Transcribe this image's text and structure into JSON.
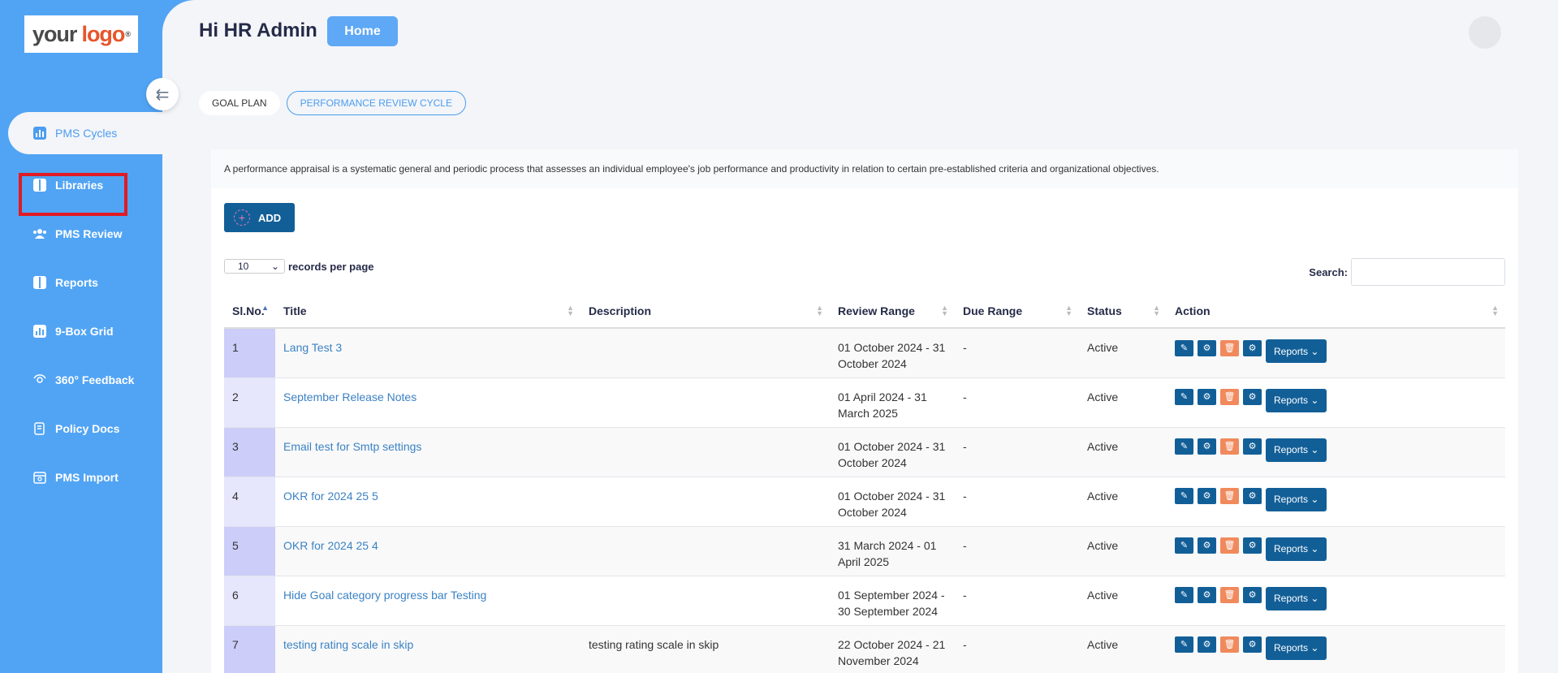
{
  "logo": {
    "your": "your",
    "logo": "logo",
    "reg": "®"
  },
  "sidebar": {
    "items": [
      {
        "label": "PMS Cycles",
        "icon": "bar-chart-icon"
      },
      {
        "label": "Libraries",
        "icon": "book-icon"
      },
      {
        "label": "PMS Review",
        "icon": "users-icon"
      },
      {
        "label": "Reports",
        "icon": "book-icon"
      },
      {
        "label": "9-Box Grid",
        "icon": "bar-chart-icon"
      },
      {
        "label": "360° Feedback",
        "icon": "feedback-icon"
      },
      {
        "label": "Policy Docs",
        "icon": "document-icon"
      },
      {
        "label": "PMS Import",
        "icon": "calendar-icon"
      }
    ]
  },
  "header": {
    "greeting": "Hi HR Admin",
    "home_label": "Home"
  },
  "tabs": [
    "GOAL PLAN",
    "PERFORMANCE REVIEW CYCLE"
  ],
  "description": "A performance appraisal is a systematic general and periodic process that assesses an individual employee's job performance and productivity in relation to certain pre-established criteria and organizational objectives.",
  "add_label": "ADD",
  "per_page": {
    "value": "10",
    "label": "records per page"
  },
  "search_label": "Search:",
  "table": {
    "headers": [
      "Sl.No.",
      "Title",
      "Description",
      "Review Range",
      "Due Range",
      "Status",
      "Action"
    ],
    "reports_label": "Reports",
    "rows": [
      {
        "sl": "1",
        "title": "Lang Test 3",
        "desc": "",
        "review": "01 October 2024 - 31 October 2024",
        "due": "-",
        "status": "Active"
      },
      {
        "sl": "2",
        "title": "September Release Notes",
        "desc": "",
        "review": "01 April 2024 - 31 March 2025",
        "due": "-",
        "status": "Active"
      },
      {
        "sl": "3",
        "title": "Email test for Smtp settings",
        "desc": "",
        "review": "01 October 2024 - 31 October 2024",
        "due": "-",
        "status": "Active"
      },
      {
        "sl": "4",
        "title": "OKR for 2024 25 5",
        "desc": "",
        "review": "01 October 2024 - 31 October 2024",
        "due": "-",
        "status": "Active"
      },
      {
        "sl": "5",
        "title": "OKR for 2024 25 4",
        "desc": "",
        "review": "31 March 2024 - 01 April 2025",
        "due": "-",
        "status": "Active"
      },
      {
        "sl": "6",
        "title": "Hide Goal category progress bar Testing",
        "desc": "",
        "review": "01 September 2024 - 30 September 2024",
        "due": "-",
        "status": "Active"
      },
      {
        "sl": "7",
        "title": "testing rating scale in skip",
        "desc": "testing rating scale in skip",
        "review": "22 October 2024 - 21 November 2024",
        "due": "-",
        "status": "Active"
      }
    ]
  }
}
